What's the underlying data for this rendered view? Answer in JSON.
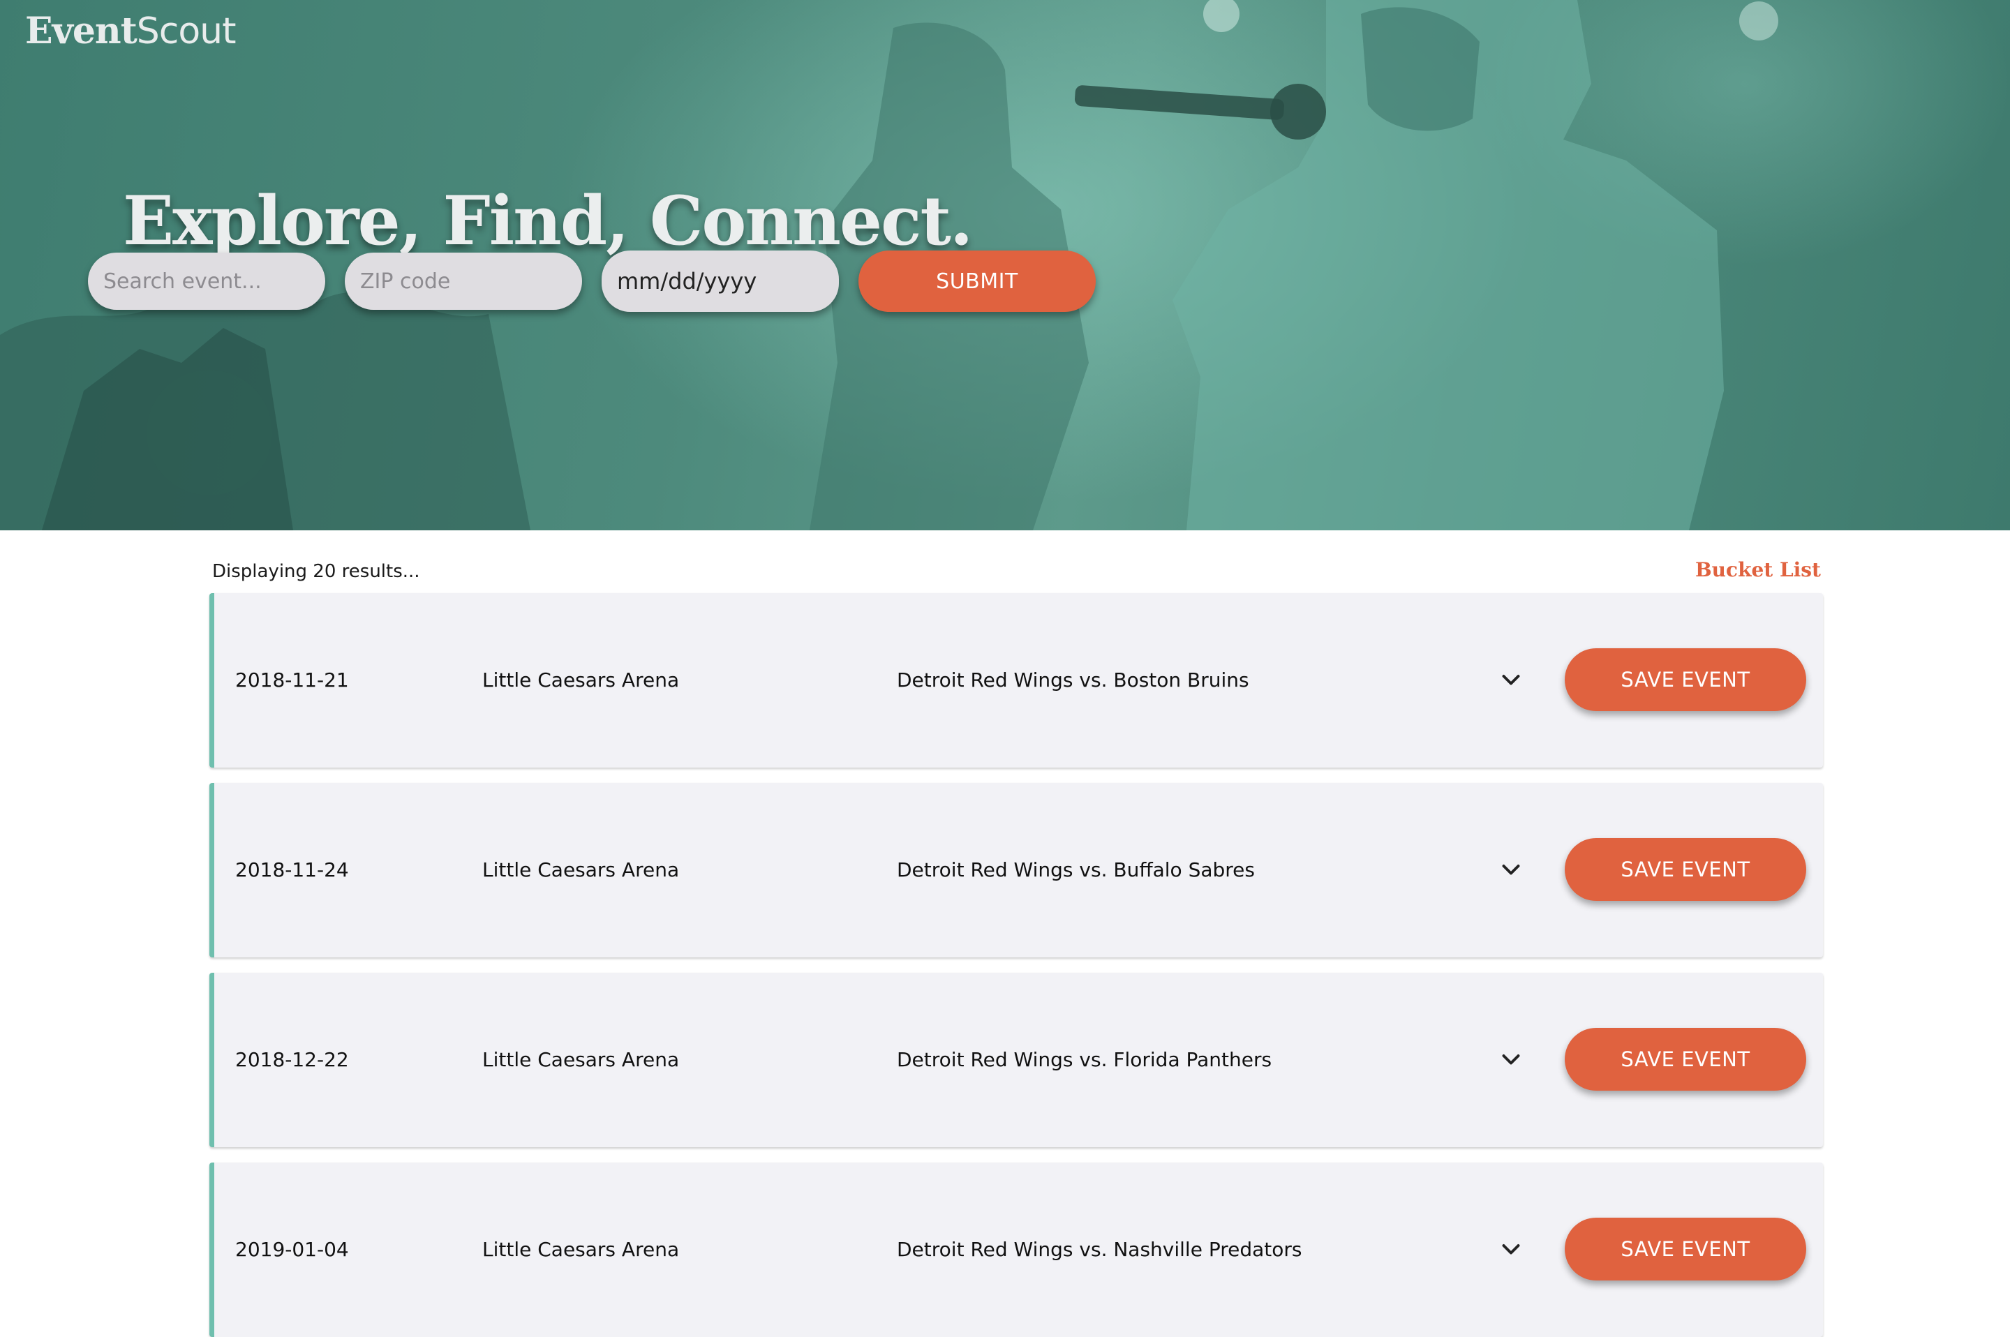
{
  "brand": {
    "name_bold": "Event",
    "name_light": "Scout"
  },
  "hero": {
    "tagline": "Explore, Find, Connect.",
    "search": {
      "event_placeholder": "Search event...",
      "zip_placeholder": "ZIP code",
      "date_placeholder": "mm/dd/yyyy",
      "submit_label": "SUBMIT"
    }
  },
  "results": {
    "count_text": "Displaying 20 results...",
    "bucket_list_label": "Bucket List",
    "save_label": "SAVE EVENT",
    "events": [
      {
        "date": "2018-11-21",
        "venue": "Little Caesars Arena",
        "title": "Detroit Red Wings vs. Boston Bruins"
      },
      {
        "date": "2018-11-24",
        "venue": "Little Caesars Arena",
        "title": "Detroit Red Wings vs. Buffalo Sabres"
      },
      {
        "date": "2018-12-22",
        "venue": "Little Caesars Arena",
        "title": "Detroit Red Wings vs. Florida Panthers"
      },
      {
        "date": "2019-01-04",
        "venue": "Little Caesars Arena",
        "title": "Detroit Red Wings vs. Nashville Predators"
      }
    ]
  },
  "icons": {
    "expand": "chevron-down-icon"
  },
  "colors": {
    "accent": "#e0623f",
    "hero_tint": "#4d8a7c",
    "card_border": "#6fbfae",
    "card_bg": "#f2f2f6"
  }
}
